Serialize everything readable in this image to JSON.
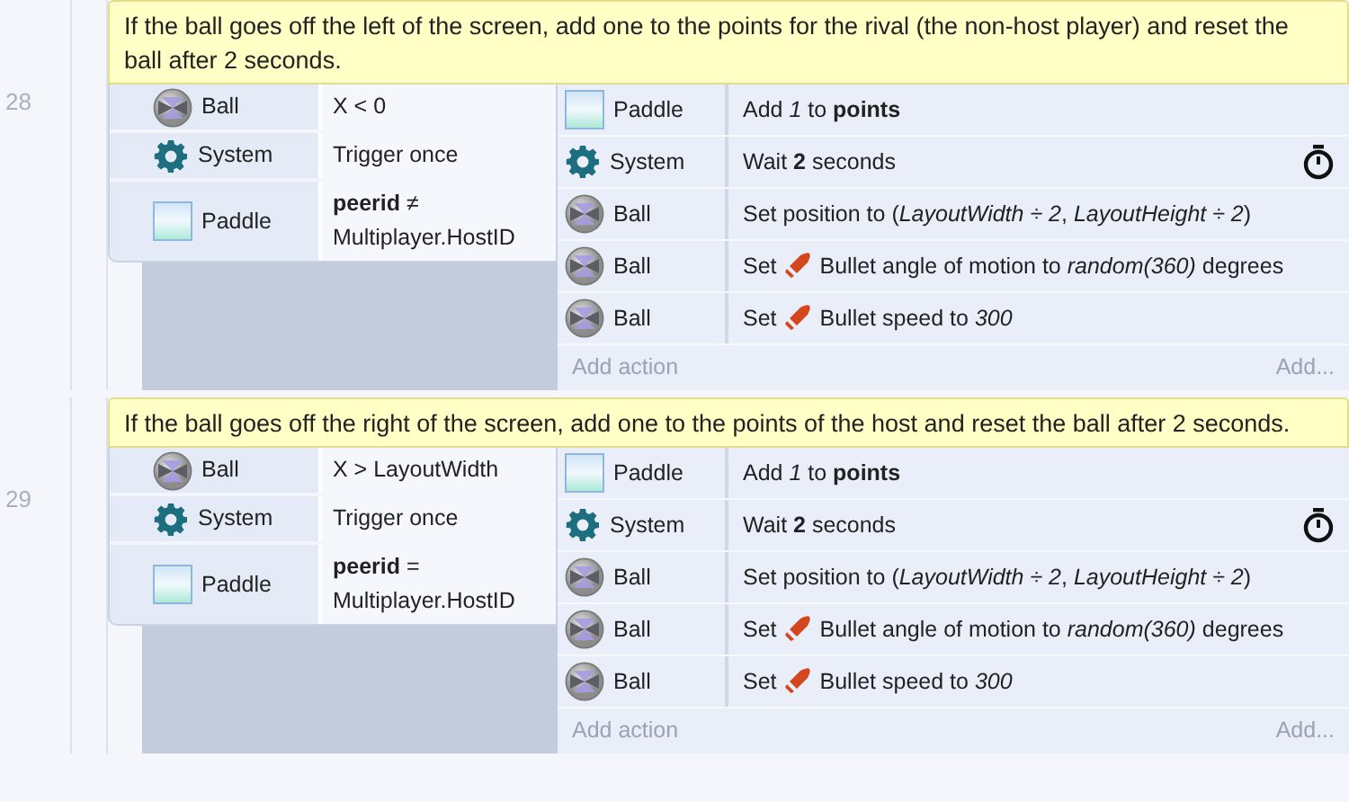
{
  "events": [
    {
      "number": "28",
      "comment": "If the ball goes off the left of the screen, add one to the points for the rival (the non-host player) and reset the ball after 2 seconds.",
      "conditions": [
        {
          "kind": "ball",
          "object": "Ball",
          "text": "X < 0"
        },
        {
          "kind": "system",
          "object": "System",
          "text": "Trigger once"
        },
        {
          "kind": "paddle",
          "object": "Paddle",
          "text": "**peerid** ≠ Multiplayer.HostID"
        }
      ],
      "actions": [
        {
          "kind": "paddle",
          "object": "Paddle",
          "text": "Add *1* to **points**",
          "timed": false
        },
        {
          "kind": "system",
          "object": "System",
          "text": "Wait **2** seconds",
          "timed": true
        },
        {
          "kind": "ball",
          "object": "Ball",
          "text": "Set position to (*LayoutWidth ÷ 2*, *LayoutHeight ÷ 2*)",
          "timed": false
        },
        {
          "kind": "ball",
          "object": "Ball",
          "verb": "Set",
          "text": "Bullet angle of motion to *random(360)* degrees",
          "timed": false
        },
        {
          "kind": "ball",
          "object": "Ball",
          "verb": "Set",
          "text": "Bullet speed to *300*",
          "timed": false
        }
      ],
      "add_action": "Add action",
      "add_more": "Add..."
    },
    {
      "number": "29",
      "comment": "If the ball goes off the right of the screen, add one to the points of the host and reset the ball after 2 seconds.",
      "conditions": [
        {
          "kind": "ball",
          "object": "Ball",
          "text": "X > LayoutWidth"
        },
        {
          "kind": "system",
          "object": "System",
          "text": "Trigger once"
        },
        {
          "kind": "paddle",
          "object": "Paddle",
          "text": "**peerid** = Multiplayer.HostID"
        }
      ],
      "actions": [
        {
          "kind": "paddle",
          "object": "Paddle",
          "text": "Add *1* to **points**",
          "timed": false
        },
        {
          "kind": "system",
          "object": "System",
          "text": "Wait **2** seconds",
          "timed": true
        },
        {
          "kind": "ball",
          "object": "Ball",
          "text": "Set position to (*LayoutWidth ÷ 2*, *LayoutHeight ÷ 2*)",
          "timed": false
        },
        {
          "kind": "ball",
          "object": "Ball",
          "verb": "Set",
          "text": "Bullet angle of motion to *random(360)* degrees",
          "timed": false
        },
        {
          "kind": "ball",
          "object": "Ball",
          "verb": "Set",
          "text": "Bullet speed to *300*",
          "timed": false
        }
      ],
      "add_action": "Add action",
      "add_more": "Add..."
    }
  ]
}
